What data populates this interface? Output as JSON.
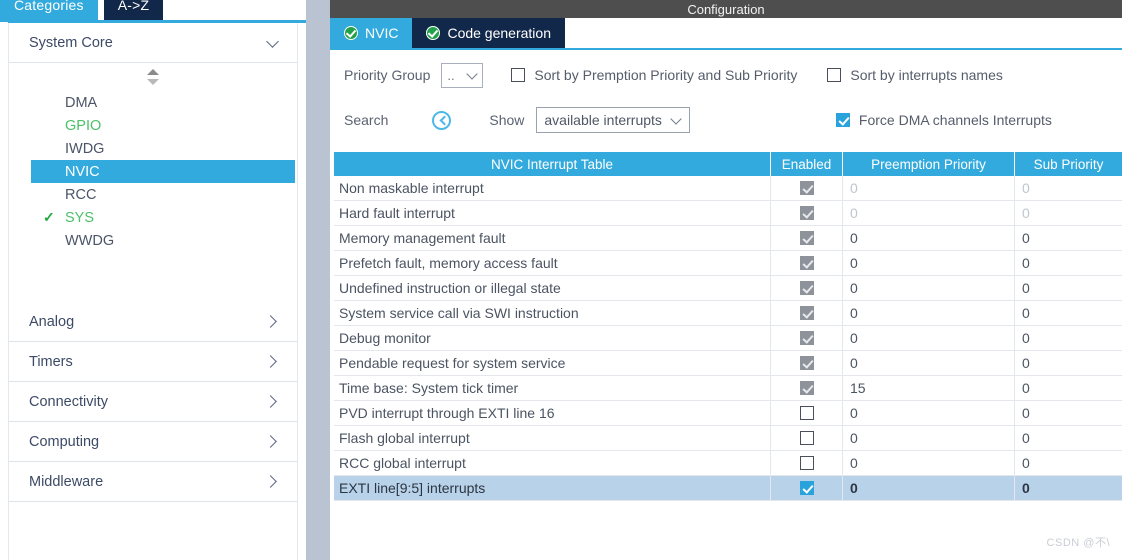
{
  "window": {
    "title": "Configuration"
  },
  "sidebar": {
    "tabs": [
      {
        "label": "Categories",
        "active": true
      },
      {
        "label": "A->Z",
        "active": false
      }
    ],
    "groups": [
      {
        "label": "System Core",
        "expanded": true
      },
      {
        "label": "Analog",
        "expanded": false
      },
      {
        "label": "Timers",
        "expanded": false
      },
      {
        "label": "Connectivity",
        "expanded": false
      },
      {
        "label": "Computing",
        "expanded": false
      },
      {
        "label": "Middleware",
        "expanded": false
      }
    ],
    "peripherals": [
      {
        "label": "DMA",
        "state": "normal"
      },
      {
        "label": "GPIO",
        "state": "configured"
      },
      {
        "label": "IWDG",
        "state": "normal"
      },
      {
        "label": "NVIC",
        "state": "selected"
      },
      {
        "label": "RCC",
        "state": "normal"
      },
      {
        "label": "SYS",
        "state": "configured-check"
      },
      {
        "label": "WWDG",
        "state": "normal"
      }
    ],
    "scroll_icon": "sort-spinner-icon"
  },
  "main": {
    "tabs": [
      {
        "label": "NVIC",
        "active": true,
        "status_icon": "check-circle-icon"
      },
      {
        "label": "Code generation",
        "active": false,
        "status_icon": "check-circle-icon"
      }
    ],
    "controls": {
      "priority_group_label": "Priority Group",
      "priority_group_value": "..",
      "sort_preemption_label": "Sort by Premption Priority and Sub Priority",
      "sort_preemption_checked": false,
      "sort_names_label": "Sort by interrupts names",
      "sort_names_checked": false,
      "search_label": "Search",
      "search_icon": "search-circle-icon",
      "show_label": "Show",
      "show_value": "available interrupts",
      "force_dma_label": "Force DMA channels Interrupts",
      "force_dma_checked": true
    },
    "table": {
      "headers": [
        "NVIC Interrupt Table",
        "Enabled",
        "Preemption Priority",
        "Sub Priority"
      ],
      "rows": [
        {
          "name": "Non maskable interrupt",
          "enabled": "disabled-checked",
          "preemption": "0",
          "sub": "0",
          "dim": true,
          "selected": false
        },
        {
          "name": "Hard fault interrupt",
          "enabled": "disabled-checked",
          "preemption": "0",
          "sub": "0",
          "dim": true,
          "selected": false
        },
        {
          "name": "Memory management fault",
          "enabled": "disabled-checked",
          "preemption": "0",
          "sub": "0",
          "dim": false,
          "selected": false
        },
        {
          "name": "Prefetch fault, memory access fault",
          "enabled": "disabled-checked",
          "preemption": "0",
          "sub": "0",
          "dim": false,
          "selected": false
        },
        {
          "name": "Undefined instruction or illegal state",
          "enabled": "disabled-checked",
          "preemption": "0",
          "sub": "0",
          "dim": false,
          "selected": false
        },
        {
          "name": "System service call via SWI instruction",
          "enabled": "disabled-checked",
          "preemption": "0",
          "sub": "0",
          "dim": false,
          "selected": false
        },
        {
          "name": "Debug monitor",
          "enabled": "disabled-checked",
          "preemption": "0",
          "sub": "0",
          "dim": false,
          "selected": false
        },
        {
          "name": "Pendable request for system service",
          "enabled": "disabled-checked",
          "preemption": "0",
          "sub": "0",
          "dim": false,
          "selected": false
        },
        {
          "name": "Time base: System tick timer",
          "enabled": "disabled-checked",
          "preemption": "15",
          "sub": "0",
          "dim": false,
          "selected": false
        },
        {
          "name": "PVD interrupt through EXTI line 16",
          "enabled": "unchecked",
          "preemption": "0",
          "sub": "0",
          "dim": false,
          "selected": false
        },
        {
          "name": "Flash global interrupt",
          "enabled": "unchecked",
          "preemption": "0",
          "sub": "0",
          "dim": false,
          "selected": false
        },
        {
          "name": "RCC global interrupt",
          "enabled": "unchecked",
          "preemption": "0",
          "sub": "0",
          "dim": false,
          "selected": false
        },
        {
          "name": "EXTI line[9:5] interrupts",
          "enabled": "checked",
          "preemption": "0",
          "sub": "0",
          "dim": false,
          "selected": true
        }
      ]
    }
  },
  "watermark": {
    "text": "CSDN @不\\"
  },
  "colors": {
    "accent_blue": "#33aadd",
    "dark_navy": "#12284a",
    "titlebar_grey": "#4e4e4e",
    "row_selected": "#b8d2e9",
    "green": "#4cc06a"
  }
}
